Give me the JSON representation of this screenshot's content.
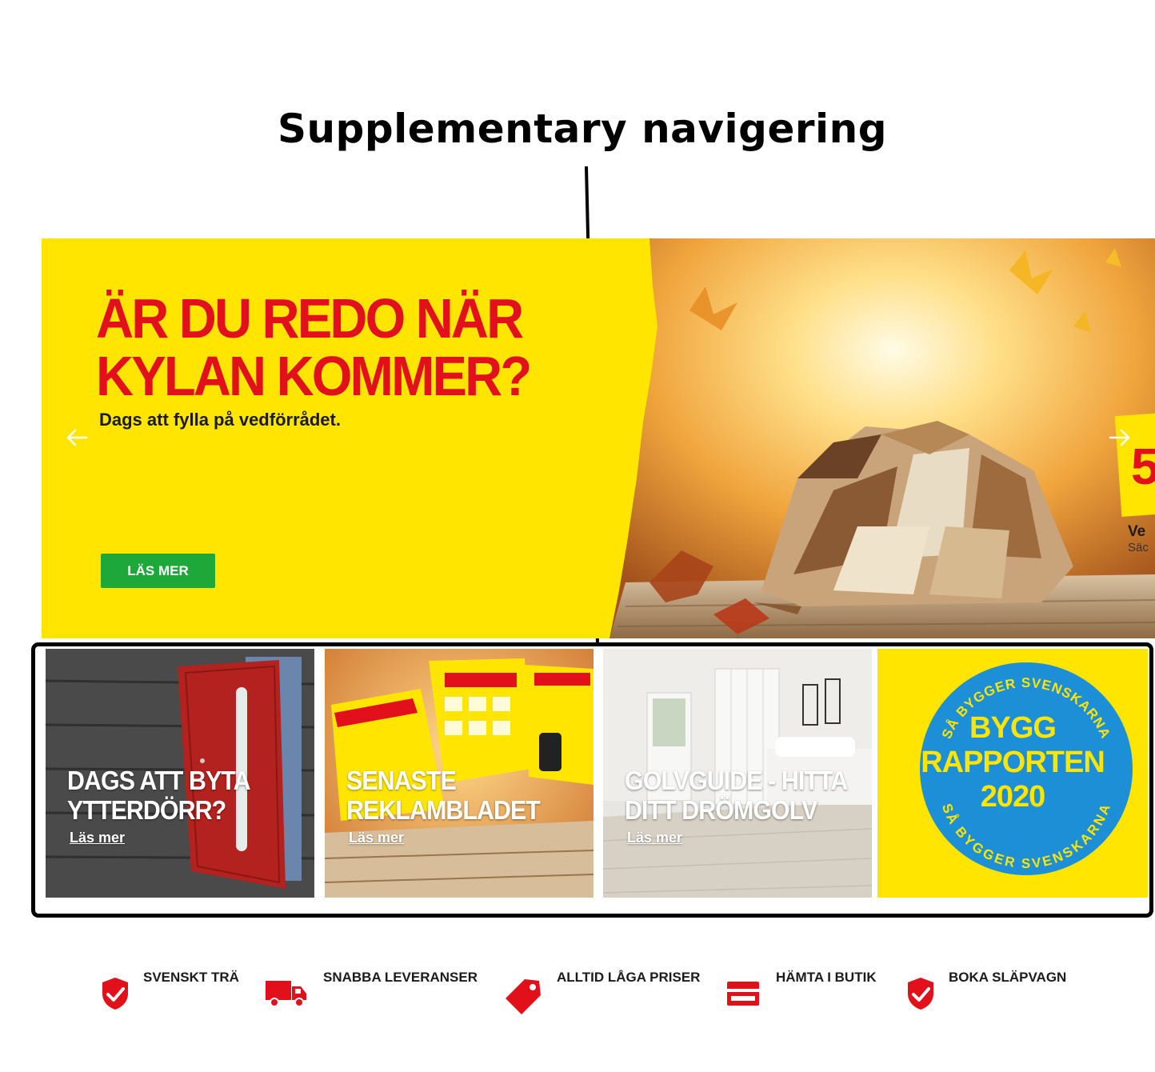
{
  "annotation": {
    "title": "Supplementary navigering"
  },
  "hero": {
    "title_lines": [
      "ÄR DU REDO NÄR",
      "KYLAN KOMMER?"
    ],
    "subtitle": "Dags att fylla på vedförrådet.",
    "button_label": "LÄS MER",
    "next_slide_peek": {
      "number": "5",
      "line1": "Ve",
      "line2": "Säc"
    }
  },
  "supplementary_nav": {
    "tiles": [
      {
        "heading_lines": [
          "DAGS ATT BYTA",
          "YTTERDÖRR?"
        ],
        "link": "Läs mer"
      },
      {
        "heading_lines": [
          "SENASTE",
          "REKLAMBLADET"
        ],
        "link": "Läs mer"
      },
      {
        "heading_lines": [
          "GOLVGUIDE - HITTA",
          "DITT DRÖMGOLV"
        ],
        "link": "Läs mer"
      },
      {
        "badge_top_text": "SÅ BYGGER SVENSKARNA",
        "badge_lines": [
          "BYGG",
          "RAPPORTEN",
          "2020"
        ],
        "badge_bottom_text": "SÅ BYGGER SVENSKARNA"
      }
    ]
  },
  "usps": [
    {
      "label": "SVENSKT TRÄ",
      "icon": "shield-check-icon"
    },
    {
      "label": "SNABBA LEVERANSER",
      "icon": "delivery-truck-icon"
    },
    {
      "label": "ALLTID LÅGA PRISER",
      "icon": "price-tag-icon"
    },
    {
      "label": "HÄMTA I BUTIK",
      "icon": "store-pickup-icon"
    },
    {
      "label": "BOKA SLÄPVAGN",
      "icon": "shield-check-icon"
    }
  ],
  "colors": {
    "brand_yellow": "#ffe500",
    "brand_red": "#e2101a",
    "button_green": "#1fa83a",
    "badge_blue": "#1d8fd6"
  }
}
